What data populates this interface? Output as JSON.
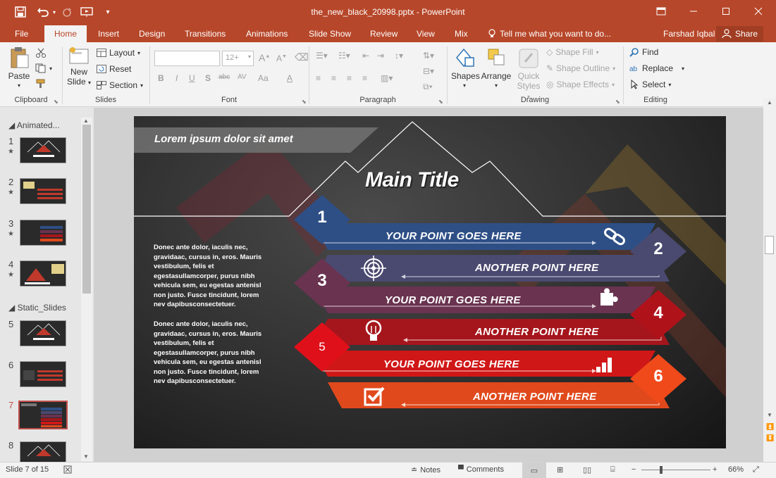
{
  "window": {
    "title": "the_new_black_20998.pptx - PowerPoint",
    "user": "Farshad Iqbal",
    "share_label": "Share"
  },
  "tabs": [
    "File",
    "Home",
    "Insert",
    "Design",
    "Transitions",
    "Animations",
    "Slide Show",
    "Review",
    "View",
    "Mix"
  ],
  "active_tab": "Home",
  "tell_me": "Tell me what you want to do...",
  "ribbon": {
    "clipboard": {
      "label": "Clipboard",
      "paste": "Paste"
    },
    "slides": {
      "label": "Slides",
      "new_slide_line1": "New",
      "new_slide_line2": "Slide",
      "layout": "Layout",
      "reset": "Reset",
      "section": "Section"
    },
    "font": {
      "label": "Font",
      "size": "12+",
      "buttons": [
        "B",
        "I",
        "U",
        "S",
        "abc",
        "AV",
        "Aa",
        "A"
      ]
    },
    "paragraph": {
      "label": "Paragraph"
    },
    "drawing": {
      "label": "Drawing",
      "shapes": "Shapes",
      "arrange": "Arrange",
      "quick_styles_line1": "Quick",
      "quick_styles_line2": "Styles",
      "shape_fill": "Shape Fill",
      "shape_outline": "Shape Outline",
      "shape_effects": "Shape Effects"
    },
    "editing": {
      "label": "Editing",
      "find": "Find",
      "replace": "Replace",
      "select": "Select"
    }
  },
  "thumb_panel": {
    "sections": [
      "Animated...",
      "Static_Slides"
    ],
    "slides": [
      {
        "num": "1",
        "starred": true
      },
      {
        "num": "2",
        "starred": true
      },
      {
        "num": "3",
        "starred": true
      },
      {
        "num": "4",
        "starred": true
      },
      {
        "num": "5",
        "starred": false
      },
      {
        "num": "6",
        "starred": false
      },
      {
        "num": "7",
        "starred": false
      },
      {
        "num": "8",
        "starred": false
      }
    ],
    "active_slide": "7"
  },
  "slide": {
    "banner": "Lorem ipsum dolor sit amet",
    "main_title": "Main Title",
    "body_paragraphs": [
      "Donec ante dolor, iaculis nec,\ngravidaac, cursus in, eros. Mauris\nvestibulum, felis et\negestasullamcorper, purus nibh\nvehicula sem, eu egestas antenisl\nnon justo. Fusce tincidunt, lorem\nnev dapibusconsectetuer.",
      "Donec ante dolor, iaculis nec,\ngravidaac, cursus in, eros. Mauris\nvestibulum, felis et\negestasullamcorper, purus nibh\nvehicula sem, eu egestas antenisl\nnon justo. Fusce tincidunt, lorem\nnev dapibusconsectetuer."
    ],
    "points": [
      {
        "num": "1",
        "text": "YOUR POINT GOES HERE",
        "icon": "link-icon",
        "color": "#2e4f86"
      },
      {
        "num": "2",
        "text": "ANOTHER POINT HERE",
        "icon": "target-icon",
        "color": "#4a4a70"
      },
      {
        "num": "3",
        "text": "YOUR POINT GOES HERE",
        "icon": "puzzle-icon",
        "color": "#6a3350"
      },
      {
        "num": "4",
        "text": "ANOTHER POINT HERE",
        "icon": "lightbulb-icon",
        "color": "#a5161c"
      },
      {
        "num": "5",
        "text": "YOUR POINT GOES HERE",
        "icon": "bar-chart-icon",
        "color": "#d01717"
      },
      {
        "num": "6",
        "text": "ANOTHER POINT HERE",
        "icon": "checkbox-icon",
        "color": "#e0491c"
      }
    ]
  },
  "status": {
    "slide_info": "Slide 7 of 15",
    "notes": "Notes",
    "comments": "Comments",
    "zoom": "66%"
  }
}
